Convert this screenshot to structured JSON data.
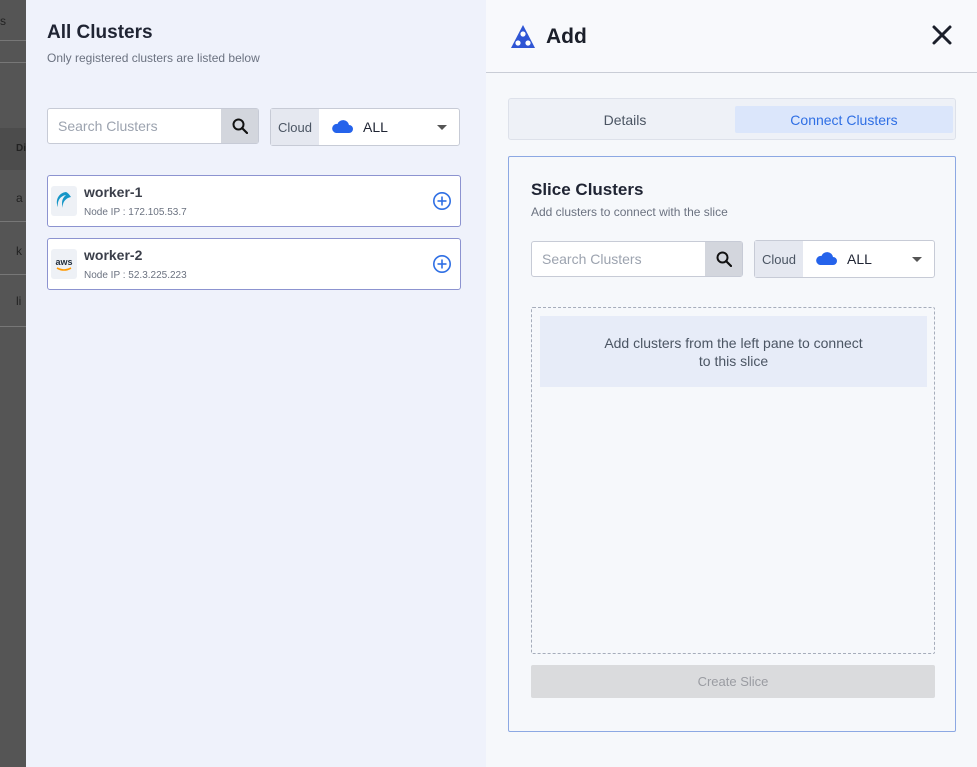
{
  "background": {
    "fragments": [
      "s",
      "Di",
      "a",
      "k",
      "li"
    ]
  },
  "left_pane": {
    "title": "All Clusters",
    "subtitle": "Only registered clusters are listed below",
    "search": {
      "placeholder": "Search Clusters",
      "value": ""
    },
    "cloud_filter": {
      "label": "Cloud",
      "value": "ALL"
    },
    "clusters": [
      {
        "name": "worker-1",
        "ip": "Node IP : 172.105.53.7",
        "logo": "linode-icon"
      },
      {
        "name": "worker-2",
        "ip": "Node IP : 52.3.225.223",
        "logo": "aws-icon",
        "logo_text": "aws"
      }
    ]
  },
  "right_pane": {
    "title": "Add",
    "tabs": [
      {
        "label": "Details",
        "active": false
      },
      {
        "label": "Connect Clusters",
        "active": true
      }
    ],
    "slice": {
      "title": "Slice Clusters",
      "subtitle": "Add clusters to connect with the slice",
      "search": {
        "placeholder": "Search Clusters",
        "value": ""
      },
      "cloud_filter": {
        "label": "Cloud",
        "value": "ALL"
      },
      "empty_message": "Add clusters from the left pane to connect to this slice",
      "create_button": "Create Slice"
    }
  },
  "colors": {
    "accent": "#2f6fe4",
    "cloud_icon": "#2563eb",
    "border": "#8c93d0"
  }
}
